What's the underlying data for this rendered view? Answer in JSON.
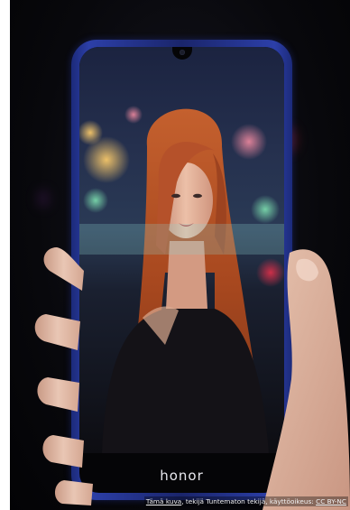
{
  "image": {
    "subject": "hand-holding-smartphone",
    "brand_logo": "honor",
    "colors": {
      "phone_frame": "#2c3fa8",
      "background": "#08080c",
      "hair": "#b8502a",
      "skin": "#e8b8a0"
    }
  },
  "caption": {
    "link_text": "Tämä kuva",
    "middle_text": ", tekijä Tuntematon tekijä, käyttöoikeus: ",
    "license_text": "CC BY-NC"
  }
}
